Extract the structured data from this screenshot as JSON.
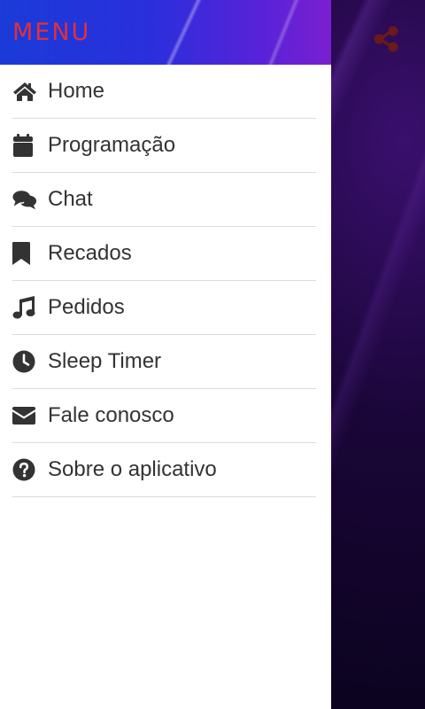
{
  "drawer": {
    "title": "MENU",
    "items": [
      {
        "label": "Home",
        "icon": "home-icon"
      },
      {
        "label": "Programação",
        "icon": "calendar-icon"
      },
      {
        "label": "Chat",
        "icon": "chat-bubbles-icon"
      },
      {
        "label": "Recados",
        "icon": "bookmark-icon"
      },
      {
        "label": "Pedidos",
        "icon": "music-note-icon"
      },
      {
        "label": "Sleep Timer",
        "icon": "clock-icon"
      },
      {
        "label": "Fale conosco",
        "icon": "envelope-icon"
      },
      {
        "label": "Sobre o aplicativo",
        "icon": "question-circle-icon"
      }
    ]
  },
  "app": {
    "share_icon": "share-icon"
  },
  "colors": {
    "menu_title": "#e0303a",
    "header_gradient_start": "#1a3bd8",
    "header_gradient_end": "#7b1fd0",
    "item_text": "#333333",
    "divider": "#dcdcdc",
    "share_icon": "#6a1a1a"
  }
}
